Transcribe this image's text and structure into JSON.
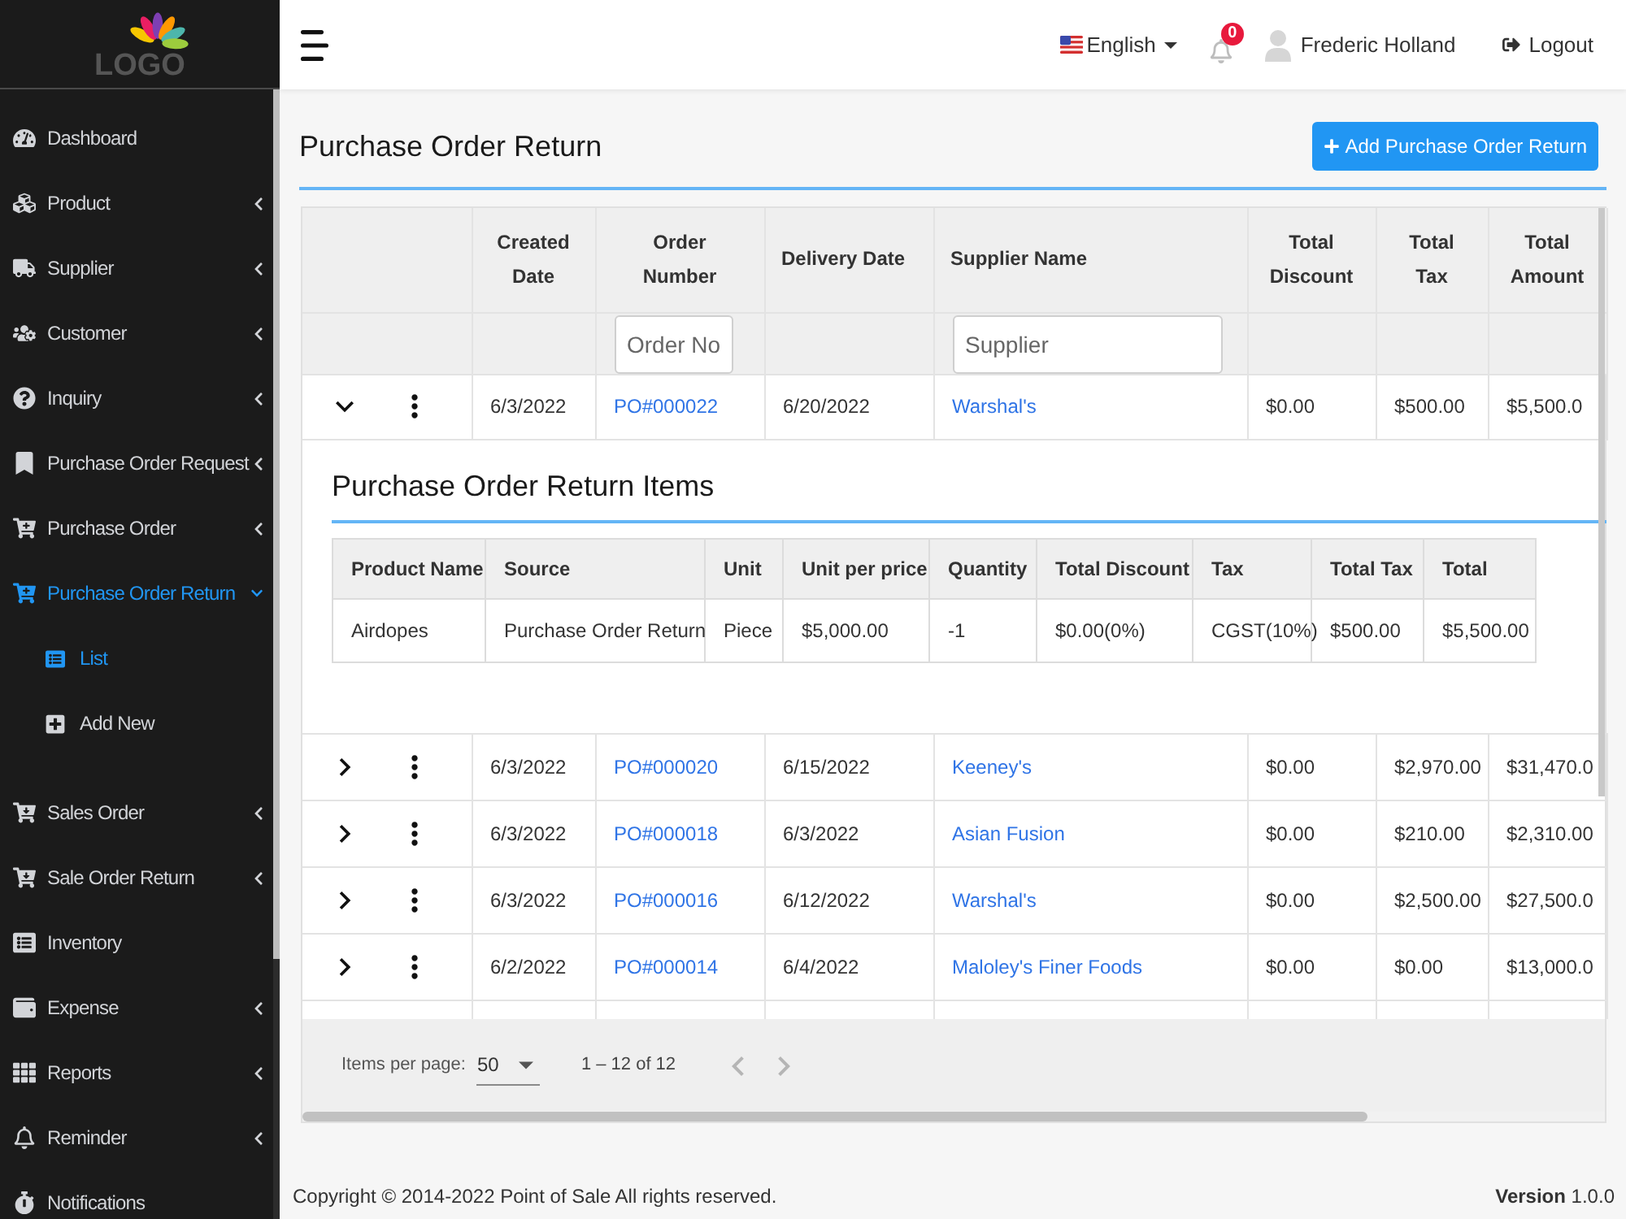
{
  "sidebar": {
    "logo": "LOGO",
    "items": [
      {
        "label": "Dashboard",
        "kind": "link",
        "selected": false
      },
      {
        "label": "Product",
        "kind": "menu",
        "selected": false,
        "expanded": false
      },
      {
        "label": "Supplier",
        "kind": "menu",
        "selected": false,
        "expanded": false
      },
      {
        "label": "Customer",
        "kind": "menu",
        "selected": false,
        "expanded": false
      },
      {
        "label": "Inquiry",
        "kind": "menu",
        "selected": false,
        "expanded": false
      },
      {
        "label": "Purchase Order Request",
        "kind": "menu",
        "selected": false,
        "expanded": false
      },
      {
        "label": "Purchase Order",
        "kind": "menu",
        "selected": false,
        "expanded": false
      },
      {
        "label": "Purchase Order Return",
        "kind": "menu",
        "selected": true,
        "expanded": true,
        "children": [
          {
            "label": "List",
            "selected": true
          },
          {
            "label": "Add New",
            "selected": false
          }
        ]
      },
      {
        "label": "Sales Order",
        "kind": "menu",
        "selected": false,
        "expanded": false
      },
      {
        "label": "Sale Order Return",
        "kind": "menu",
        "selected": false,
        "expanded": false
      },
      {
        "label": "Inventory",
        "kind": "link",
        "selected": false
      },
      {
        "label": "Expense",
        "kind": "menu",
        "selected": false,
        "expanded": false
      },
      {
        "label": "Reports",
        "kind": "menu",
        "selected": false,
        "expanded": false
      },
      {
        "label": "Reminder",
        "kind": "menu",
        "selected": false,
        "expanded": false
      },
      {
        "label": "Notifications",
        "kind": "link",
        "selected": false
      }
    ]
  },
  "top_bar": {
    "language": "English",
    "notification_count": "0",
    "user_name": "Frederic Holland",
    "logout": "Logout"
  },
  "page": {
    "title": "Purchase Order Return",
    "add_button": "Add Purchase Order Return"
  },
  "table": {
    "columns": [
      {
        "label": "Created Date",
        "kind": "text"
      },
      {
        "label": "Order Number",
        "kind": "link",
        "filter": {
          "placeholder": "Order No"
        }
      },
      {
        "label": "Delivery Date",
        "kind": "text"
      },
      {
        "label": "Supplier Name",
        "kind": "link",
        "filter": {
          "placeholder": "Supplier"
        }
      },
      {
        "label": "Total Discount",
        "kind": "text"
      },
      {
        "label": "Total Tax",
        "kind": "text"
      },
      {
        "label": "Total Amount",
        "kind": "text"
      }
    ],
    "rows": [
      {
        "expanded": true,
        "cells": [
          "6/3/2022",
          "PO#000022",
          "6/20/2022",
          "Warshal's",
          "$0.00",
          "$500.00",
          "$5,500.0"
        ],
        "items": {
          "title": "Purchase Order Return Items",
          "columns": [
            "Product Name",
            "Source",
            "Unit",
            "Unit per price",
            "Quantity",
            "Total Discount",
            "Tax",
            "Total Tax",
            "Total"
          ],
          "rows": [
            [
              "Airdopes",
              "Purchase Order Return",
              "Piece",
              "$5,000.00",
              "-1",
              "$0.00(0%)",
              "CGST(10%)",
              "$500.00",
              "$5,500.00"
            ]
          ]
        }
      },
      {
        "expanded": false,
        "cells": [
          "6/3/2022",
          "PO#000020",
          "6/15/2022",
          "Keeney's",
          "$0.00",
          "$2,970.00",
          "$31,470.0"
        ]
      },
      {
        "expanded": false,
        "cells": [
          "6/3/2022",
          "PO#000018",
          "6/3/2022",
          "Asian Fusion",
          "$0.00",
          "$210.00",
          "$2,310.00"
        ]
      },
      {
        "expanded": false,
        "cells": [
          "6/3/2022",
          "PO#000016",
          "6/12/2022",
          "Warshal's",
          "$0.00",
          "$2,500.00",
          "$27,500.0"
        ]
      },
      {
        "expanded": false,
        "cells": [
          "6/2/2022",
          "PO#000014",
          "6/4/2022",
          "Maloley's Finer Foods",
          "$0.00",
          "$0.00",
          "$13,000.0"
        ]
      }
    ]
  },
  "paginator": {
    "label": "Items per page:",
    "page_size": "50",
    "range": "1 – 12 of 12",
    "previous": {
      "disabled": true
    },
    "next": {
      "disabled": true
    }
  },
  "footer": {
    "copyright": "Copyright © 2014-2022 Point of Sale All rights reserved.",
    "version": "**Version** 1.0.0"
  }
}
